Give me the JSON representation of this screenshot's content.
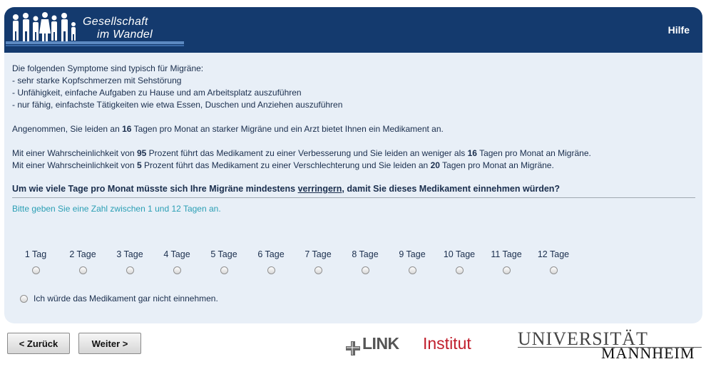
{
  "header": {
    "brand_line1": "Gesellschaft",
    "brand_line2": "im Wandel",
    "help_label": "Hilfe"
  },
  "intro": {
    "line1": "Die folgenden Symptome sind typisch für Migräne:",
    "line2": "- sehr starke Kopfschmerzen mit Sehstörung",
    "line3": "- Unfähigkeit, einfache Aufgaben zu Hause und am Arbeitsplatz auszuführen",
    "line4": "- nur fähig, einfachste Tätigkeiten wie etwa Essen, Duschen und Anziehen auszuführen"
  },
  "scenario": {
    "pre": "Angenommen, Sie leiden an ",
    "days": "16",
    "post": " Tagen pro Monat an starker Migräne und ein Arzt bietet Ihnen ein Medikament an."
  },
  "outcome1": {
    "pre": "Mit einer Wahrscheinlichkeit von ",
    "pct": "95",
    "mid": " Prozent führt das Medikament zu einer Verbesserung und Sie leiden an weniger als ",
    "days": "16",
    "post": " Tagen pro Monat an Migräne."
  },
  "outcome2": {
    "pre": "Mit einer Wahrscheinlichkeit von ",
    "pct": "5",
    "mid": " Prozent führt das Medikament zu einer Verschlechterung und Sie leiden an ",
    "days": "20",
    "post": " Tagen pro Monat an Migräne."
  },
  "question": {
    "pre": "Um wie viele Tage pro Monat müsste sich Ihre Migräne mindestens ",
    "underlined": "verringern",
    "post": ", damit Sie dieses Medikament einnehmen würden?"
  },
  "hint": "Bitte geben Sie eine Zahl zwischen 1 und 12 Tagen an.",
  "options": [
    "1 Tag",
    "2 Tage",
    "3 Tage",
    "4 Tage",
    "5 Tage",
    "6 Tage",
    "7 Tage",
    "8 Tage",
    "9 Tage",
    "10 Tage",
    "11 Tage",
    "12 Tage"
  ],
  "no_take_option": "Ich würde das Medikament gar nicht einnehmen.",
  "nav": {
    "back_label": "< Zurück",
    "next_label": "Weiter >"
  },
  "logos": {
    "link_bold": "LINK",
    "link_institut": "Institut",
    "uni_line1": "UNIVERSITÄT",
    "uni_line2": "MANNHEIM"
  },
  "colors": {
    "header_bg": "#143a6e",
    "content_bg": "#e8eff7",
    "hint_color": "#2b9fb5",
    "link_red": "#c01e2c"
  }
}
